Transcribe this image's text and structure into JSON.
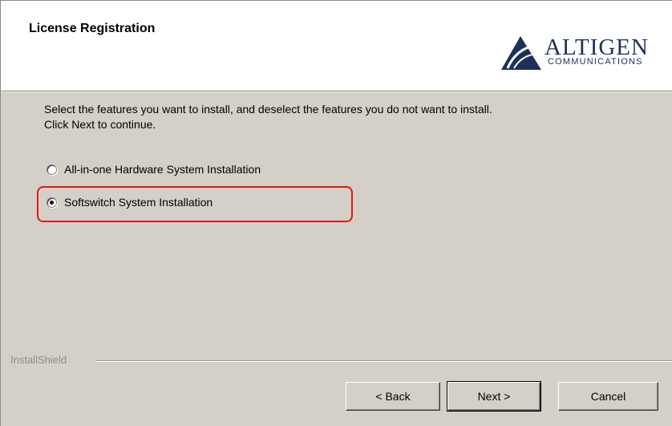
{
  "header": {
    "title": "License Registration",
    "logo": {
      "brand": "ALTIGEN",
      "sub": "COMMUNICATIONS",
      "icon": "altigen-logo-icon",
      "brand_color": "#1e2f5a"
    }
  },
  "main": {
    "instruction_line1": "Select the features you want to install, and deselect the features you do not want to install.",
    "instruction_line2": "Click Next to continue.",
    "options": [
      {
        "label": "All-in-one Hardware System Installation",
        "selected": false
      },
      {
        "label": "Softswitch System Installation",
        "selected": true
      }
    ],
    "highlight_color": "#e01818"
  },
  "footer": {
    "installshield_label": "InstallShield",
    "back_label": "< Back",
    "next_label": "Next >",
    "cancel_label": "Cancel"
  },
  "colors": {
    "dialog_bg": "#d4d0c8",
    "header_bg": "#ffffff"
  }
}
